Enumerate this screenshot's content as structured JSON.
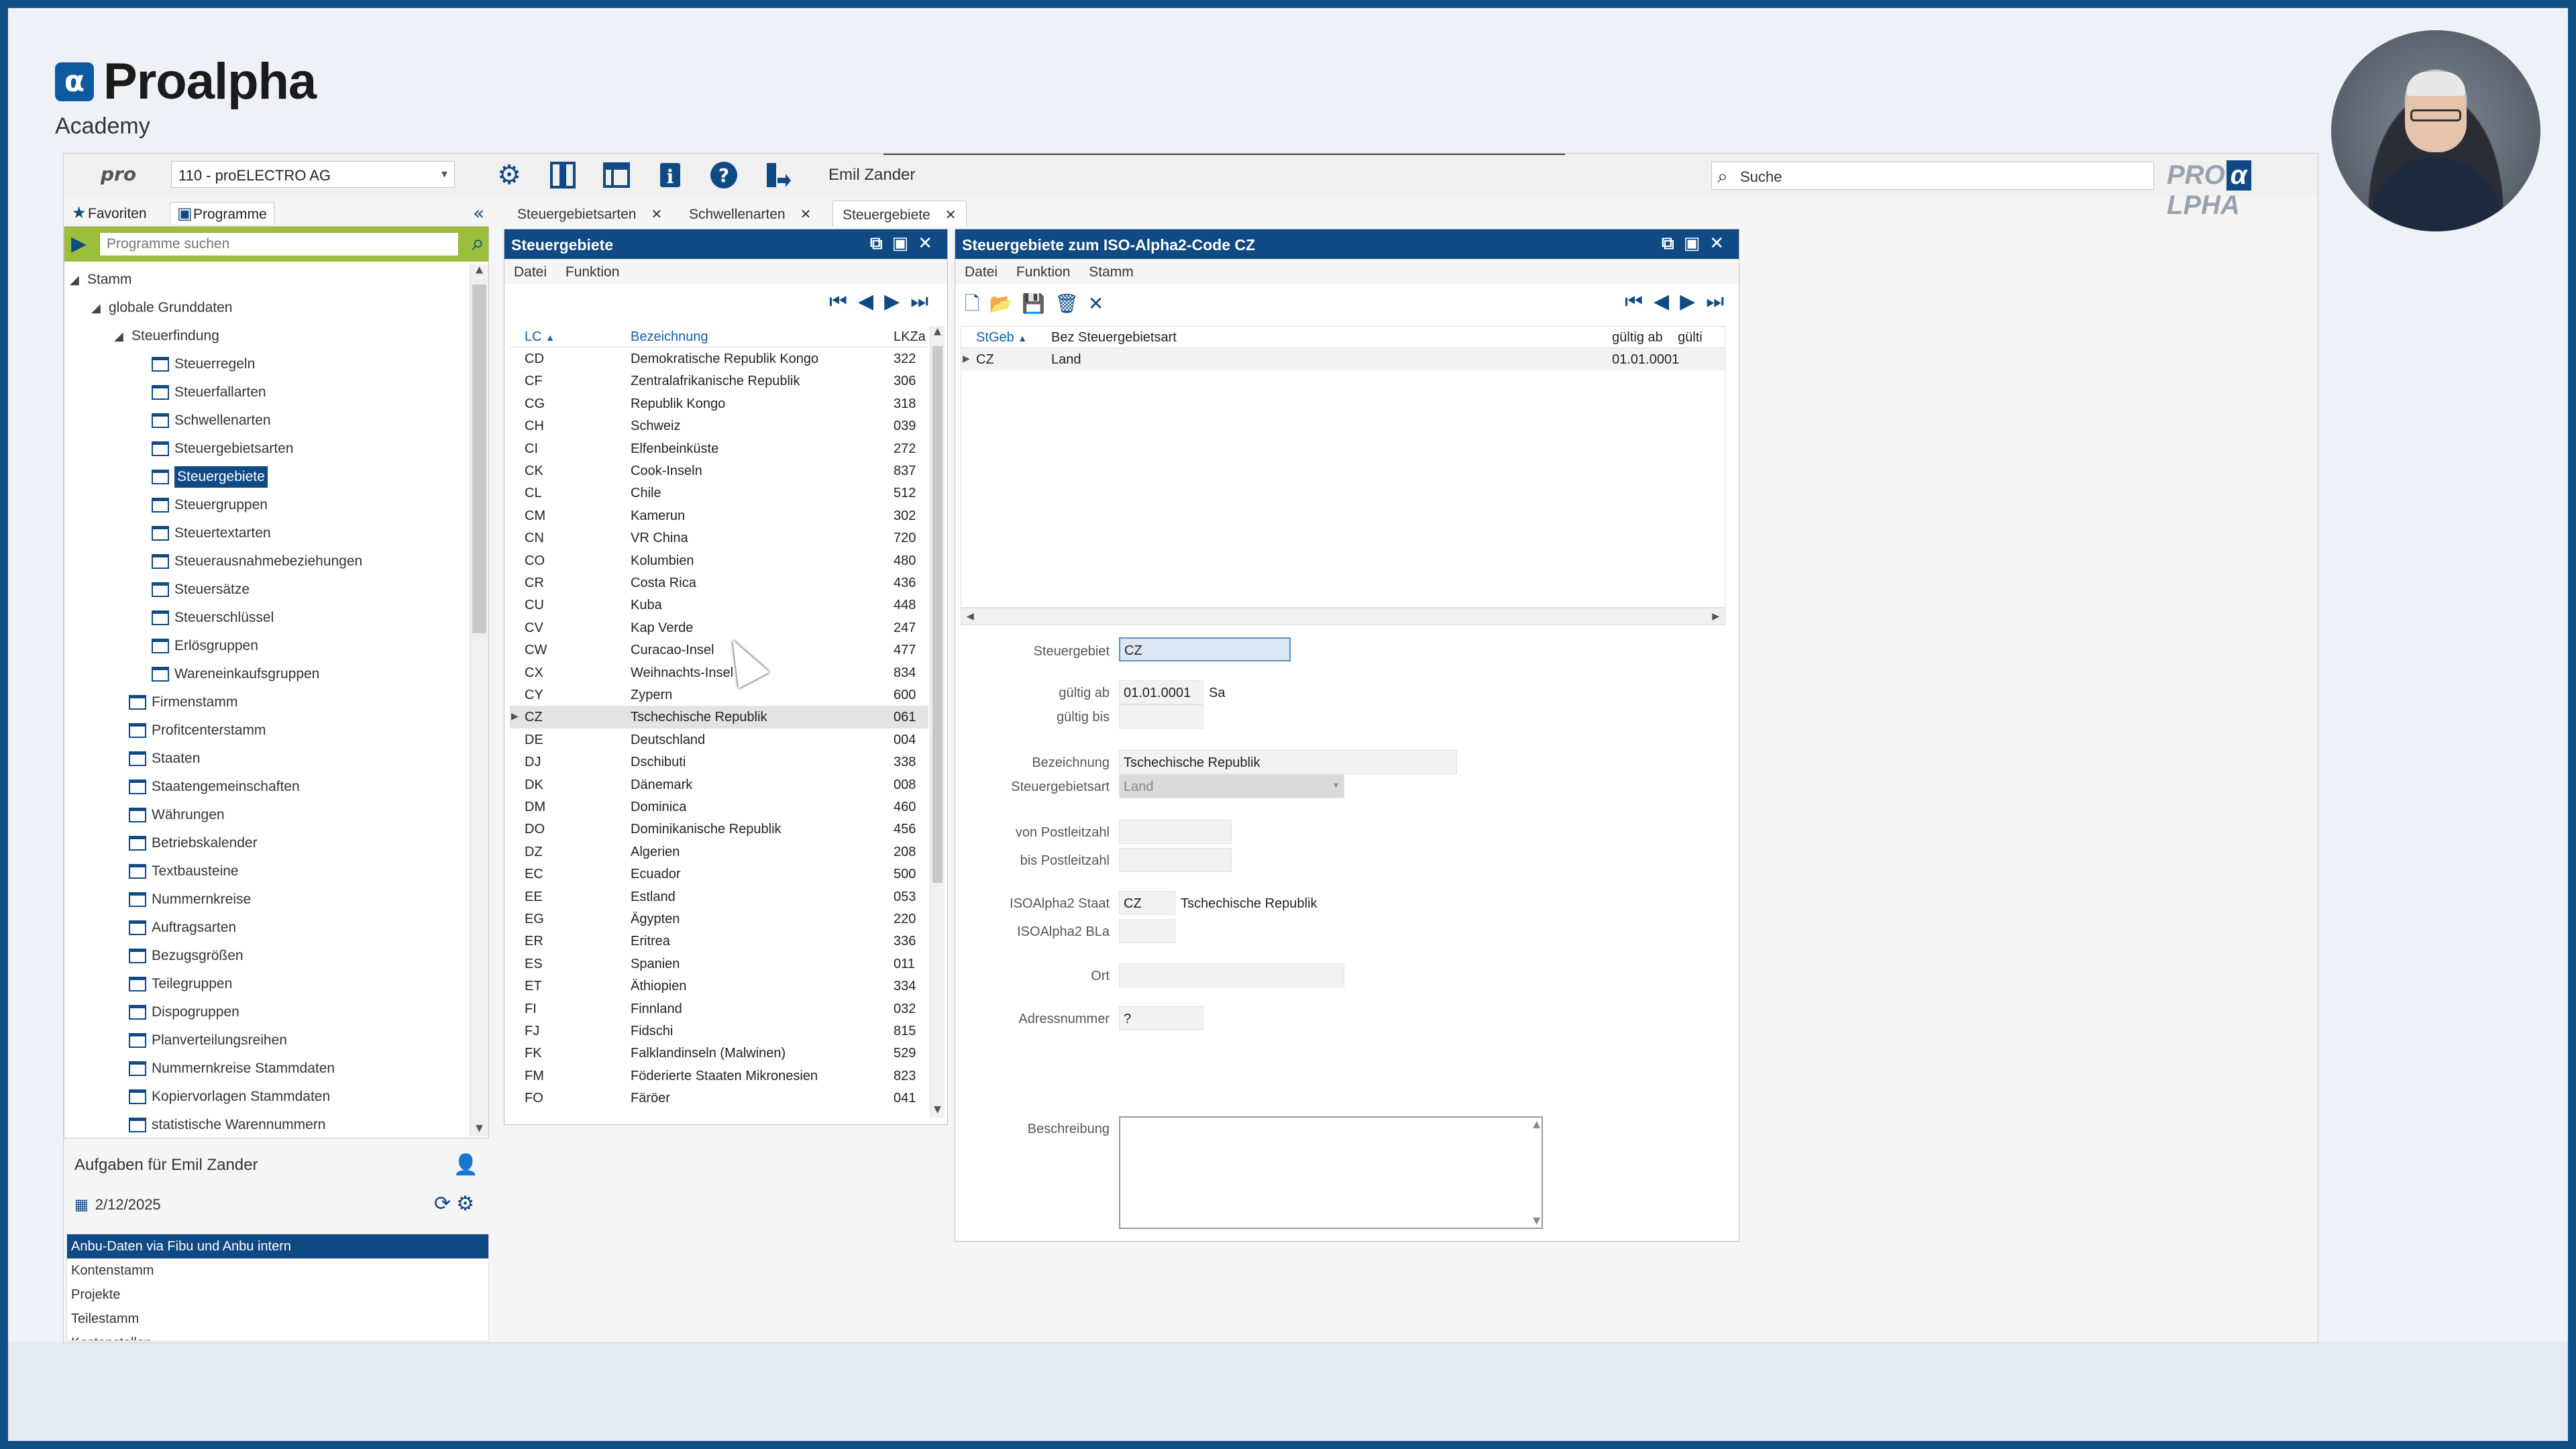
{
  "brand": {
    "name": "Proalpha",
    "sub": "Academy",
    "mark": "α"
  },
  "toolbar": {
    "pro_logo": "pro",
    "company": "110 - proELECTRO AG",
    "user": "Emil Zander",
    "search_placeholder": "Suche",
    "logo_left": "PRO",
    "logo_alpha": "α",
    "logo_right": "LPHA"
  },
  "left_tabs": {
    "favorites": "Favoriten",
    "programs": "Programme"
  },
  "program_search": {
    "placeholder": "Programme suchen"
  },
  "tree": [
    {
      "label": "Stamm",
      "level": 0,
      "type": "folder"
    },
    {
      "label": "globale Grunddaten",
      "level": 1,
      "type": "folder"
    },
    {
      "label": "Steuerfindung",
      "level": 2,
      "type": "folder"
    },
    {
      "label": "Steuerregeln",
      "level": 3,
      "type": "doc"
    },
    {
      "label": "Steuerfallarten",
      "level": 3,
      "type": "doc"
    },
    {
      "label": "Schwellenarten",
      "level": 3,
      "type": "doc"
    },
    {
      "label": "Steuergebietsarten",
      "level": 3,
      "type": "doc"
    },
    {
      "label": "Steuergebiete",
      "level": 3,
      "type": "doc",
      "selected": true
    },
    {
      "label": "Steuergruppen",
      "level": 3,
      "type": "doc"
    },
    {
      "label": "Steuertextarten",
      "level": 3,
      "type": "doc"
    },
    {
      "label": "Steuerausnahmebeziehungen",
      "level": 3,
      "type": "doc"
    },
    {
      "label": "Steuersätze",
      "level": 3,
      "type": "doc"
    },
    {
      "label": "Steuerschlüssel",
      "level": 3,
      "type": "doc"
    },
    {
      "label": "Erlösgruppen",
      "level": 3,
      "type": "doc"
    },
    {
      "label": "Wareneinkaufsgruppen",
      "level": 3,
      "type": "doc"
    },
    {
      "label": "Firmenstamm",
      "level": 2,
      "type": "doc"
    },
    {
      "label": "Profitcenterstamm",
      "level": 2,
      "type": "doc"
    },
    {
      "label": "Staaten",
      "level": 2,
      "type": "doc"
    },
    {
      "label": "Staatengemeinschaften",
      "level": 2,
      "type": "doc"
    },
    {
      "label": "Währungen",
      "level": 2,
      "type": "doc"
    },
    {
      "label": "Betriebskalender",
      "level": 2,
      "type": "doc"
    },
    {
      "label": "Textbausteine",
      "level": 2,
      "type": "doc"
    },
    {
      "label": "Nummernkreise",
      "level": 2,
      "type": "doc"
    },
    {
      "label": "Auftragsarten",
      "level": 2,
      "type": "doc"
    },
    {
      "label": "Bezugsgrößen",
      "level": 2,
      "type": "doc"
    },
    {
      "label": "Teilegruppen",
      "level": 2,
      "type": "doc"
    },
    {
      "label": "Dispogruppen",
      "level": 2,
      "type": "doc"
    },
    {
      "label": "Planverteilungsreihen",
      "level": 2,
      "type": "doc"
    },
    {
      "label": "Nummernkreise Stammdaten",
      "level": 2,
      "type": "doc"
    },
    {
      "label": "Kopiervorlagen Stammdaten",
      "level": 2,
      "type": "doc"
    },
    {
      "label": "statistische Warennummern",
      "level": 2,
      "type": "doc"
    }
  ],
  "tasks": {
    "title": "Aufgaben für Emil Zander",
    "date": "2/12/2025",
    "items": [
      "Anbu-Daten via Fibu und Anbu intern",
      "Kontenstamm",
      "Projekte",
      "Teilestamm",
      "Kostenstellen"
    ]
  },
  "doc_tabs": [
    "Steuergebietsarten",
    "Schwellenarten",
    "Steuergebiete"
  ],
  "list_window": {
    "title": "Steuergebiete",
    "menu": [
      "Datei",
      "Funktion"
    ],
    "columns": [
      "LC",
      "Bezeichnung",
      "LKZa"
    ],
    "rows": [
      [
        "CD",
        "Demokratische Republik Kongo",
        "322"
      ],
      [
        "CF",
        "Zentralafrikanische Republik",
        "306"
      ],
      [
        "CG",
        "Republik Kongo",
        "318"
      ],
      [
        "CH",
        "Schweiz",
        "039"
      ],
      [
        "CI",
        "Elfenbeinküste",
        "272"
      ],
      [
        "CK",
        "Cook-Inseln",
        "837"
      ],
      [
        "CL",
        "Chile",
        "512"
      ],
      [
        "CM",
        "Kamerun",
        "302"
      ],
      [
        "CN",
        "VR China",
        "720"
      ],
      [
        "CO",
        "Kolumbien",
        "480"
      ],
      [
        "CR",
        "Costa Rica",
        "436"
      ],
      [
        "CU",
        "Kuba",
        "448"
      ],
      [
        "CV",
        "Kap Verde",
        "247"
      ],
      [
        "CW",
        "Curacao-Insel",
        "477"
      ],
      [
        "CX",
        "Weihnachts-Insel",
        "834"
      ],
      [
        "CY",
        "Zypern",
        "600"
      ],
      [
        "CZ",
        "Tschechische Republik",
        "061"
      ],
      [
        "DE",
        "Deutschland",
        "004"
      ],
      [
        "DJ",
        "Dschibuti",
        "338"
      ],
      [
        "DK",
        "Dänemark",
        "008"
      ],
      [
        "DM",
        "Dominica",
        "460"
      ],
      [
        "DO",
        "Dominikanische Republik",
        "456"
      ],
      [
        "DZ",
        "Algerien",
        "208"
      ],
      [
        "EC",
        "Ecuador",
        "500"
      ],
      [
        "EE",
        "Estland",
        "053"
      ],
      [
        "EG",
        "Ägypten",
        "220"
      ],
      [
        "ER",
        "Eritrea",
        "336"
      ],
      [
        "ES",
        "Spanien",
        "011"
      ],
      [
        "ET",
        "Äthiopien",
        "334"
      ],
      [
        "FI",
        "Finnland",
        "032"
      ],
      [
        "FJ",
        "Fidschi",
        "815"
      ],
      [
        "FK",
        "Falklandinseln (Malwinen)",
        "529"
      ],
      [
        "FM",
        "Föderierte Staaten Mikronesien",
        "823"
      ],
      [
        "FO",
        "Färöer",
        "041"
      ]
    ],
    "selected_code": "CZ"
  },
  "detail_window": {
    "title": "Steuergebiete zum ISO-Alpha2-Code CZ",
    "menu": [
      "Datei",
      "Funktion",
      "Stamm"
    ],
    "columns": [
      "StGeb",
      "Bez Steuergebietsart",
      "gültig ab",
      "gülti"
    ],
    "rows": [
      [
        "CZ",
        "Land",
        "01.01.0001"
      ]
    ],
    "form": {
      "steuergebiet_label": "Steuergebiet",
      "steuergebiet": "CZ",
      "gueltig_ab_label": "gültig ab",
      "gueltig_ab": "01.01.0001",
      "weekday": "Sa",
      "gueltig_bis_label": "gültig bis",
      "gueltig_bis": "",
      "bezeichnung_label": "Bezeichnung",
      "bezeichnung": "Tschechische Republik",
      "steuergebietsart_label": "Steuergebietsart",
      "steuergebietsart": "Land",
      "von_plz_label": "von Postleitzahl",
      "von_plz": "",
      "bis_plz_label": "bis Postleitzahl",
      "bis_plz": "",
      "iso_staat_label": "ISOAlpha2 Staat",
      "iso_staat": "CZ",
      "iso_staat_name": "Tschechische Republik",
      "iso_bla_label": "ISOAlpha2 BLa",
      "iso_bla": "",
      "ort_label": "Ort",
      "ort": "",
      "adressnummer_label": "Adressnummer",
      "adressnummer": "?",
      "beschreibung_label": "Beschreibung"
    }
  }
}
